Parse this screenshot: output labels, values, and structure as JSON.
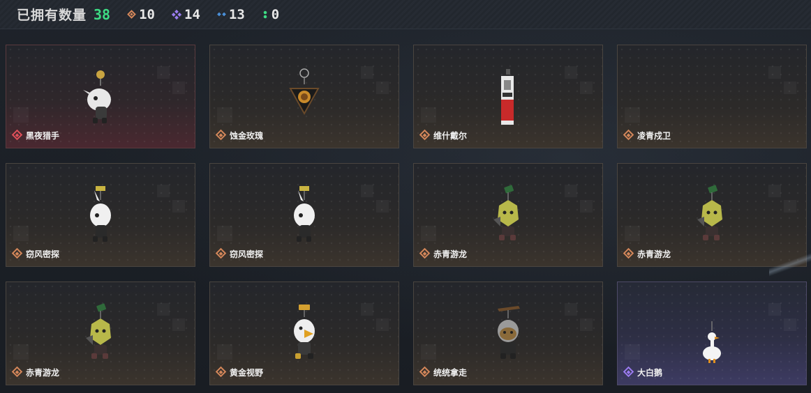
{
  "header": {
    "owned_label": "已拥有数量",
    "owned_count": "38",
    "stats": [
      {
        "icon": "orange-diamond-icon",
        "value": "10"
      },
      {
        "icon": "purple-diamond-icon",
        "value": "14"
      },
      {
        "icon": "blue-diamond-icon",
        "value": "13"
      },
      {
        "icon": "green-dots-icon",
        "value": "0"
      }
    ]
  },
  "items": [
    {
      "name": "黑夜猎手",
      "rarity": "red"
    },
    {
      "name": "蚀金玫瑰",
      "rarity": "orange"
    },
    {
      "name": "维什戴尔",
      "rarity": "orange"
    },
    {
      "name": "凌青戍卫",
      "rarity": "orange"
    },
    {
      "name": "窃风密探",
      "rarity": "orange"
    },
    {
      "name": "窃风密探",
      "rarity": "orange"
    },
    {
      "name": "赤青游龙",
      "rarity": "orange"
    },
    {
      "name": "赤青游龙",
      "rarity": "orange"
    },
    {
      "name": "赤青游龙",
      "rarity": "orange"
    },
    {
      "name": "黄金视野",
      "rarity": "orange"
    },
    {
      "name": "统统拿走",
      "rarity": "orange"
    },
    {
      "name": "大白鹅",
      "rarity": "purple"
    }
  ],
  "colors": {
    "count_green": "#3ddc84",
    "rarity_orange": "#d4875a",
    "rarity_red": "#e0505a",
    "rarity_purple": "#9b7cf0",
    "rarity_blue": "#4a90d9"
  }
}
